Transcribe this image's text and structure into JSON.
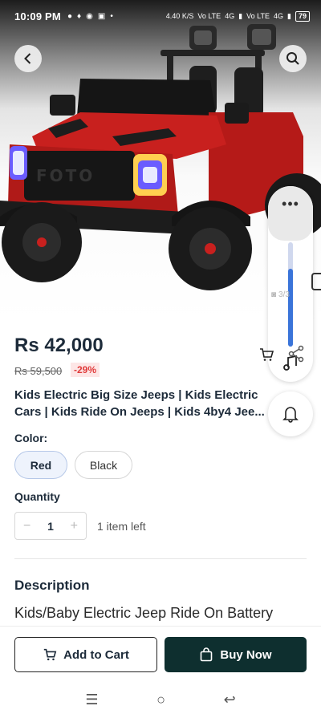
{
  "status_bar": {
    "time": "10:09 PM",
    "network_speed": "4.40 K/S",
    "network_labels": [
      "Vo LTE",
      "4G",
      "Vo LTE",
      "4G"
    ],
    "battery": "79"
  },
  "gallery": {
    "counter": "3/3",
    "icons": [
      "back-arrow-icon",
      "search-icon"
    ]
  },
  "overlay": {
    "volume_level": 0.75,
    "menu_dots": "•••"
  },
  "product": {
    "price": "Rs 42,000",
    "original_price": "Rs 59,500",
    "discount": "-29%",
    "title": "Kids Electric Big Size Jeeps | Kids Electric Cars | Kids Ride On Jeeps | Kids 4by4 Jee..."
  },
  "options": {
    "color_label": "Color:",
    "colors": [
      {
        "label": "Red",
        "selected": true
      },
      {
        "label": "Black",
        "selected": false
      }
    ],
    "quantity_label": "Quantity",
    "quantity_value": "1",
    "minus": "−",
    "plus": "+",
    "stock_text": "1 item left"
  },
  "description": {
    "heading": "Description",
    "text": "Kids/Baby Electric Jeep Ride On Battery"
  },
  "actions": {
    "add_to_cart": "Add to Cart",
    "buy_now": "Buy Now"
  },
  "nav": {
    "recents": "☰",
    "home": "○",
    "back": "↩"
  },
  "colors": {
    "accent_dark": "#0e2f2f",
    "discount_red": "#e03b3b",
    "selected_chip_bg": "#eef3fc",
    "car_red": "#c8201e"
  }
}
